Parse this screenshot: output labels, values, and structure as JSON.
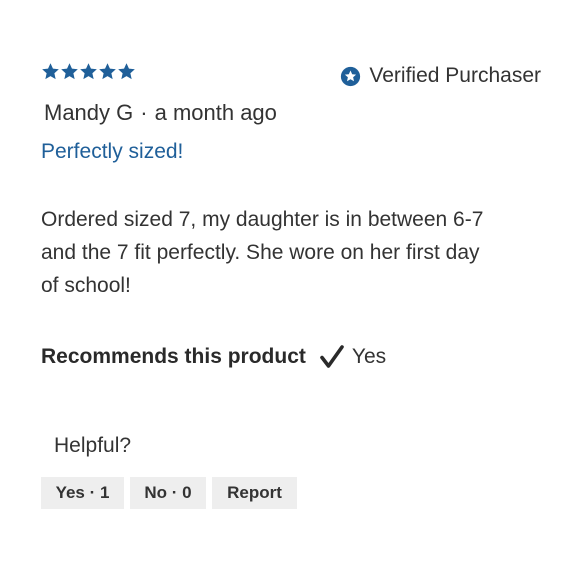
{
  "review": {
    "rating": 5,
    "max_rating": 5,
    "star_color": "#1f5f99",
    "verified_label": "Verified Purchaser",
    "verified_icon": "star-badge-icon",
    "author": "Mandy G",
    "separator": "·",
    "time_ago": "a month ago",
    "title": "Perfectly sized!",
    "title_color": "#1f5f99",
    "body": "Ordered sized 7, my daughter is in between 6-7 and the 7 fit perfectly. She wore on her first day of school!",
    "recommend_label": "Recommends this product",
    "recommend_icon": "checkmark-icon",
    "recommend_value": "Yes"
  },
  "helpful": {
    "label": "Helpful?",
    "yes_label": "Yes · 1",
    "no_label": "No · 0",
    "report_label": "Report"
  }
}
